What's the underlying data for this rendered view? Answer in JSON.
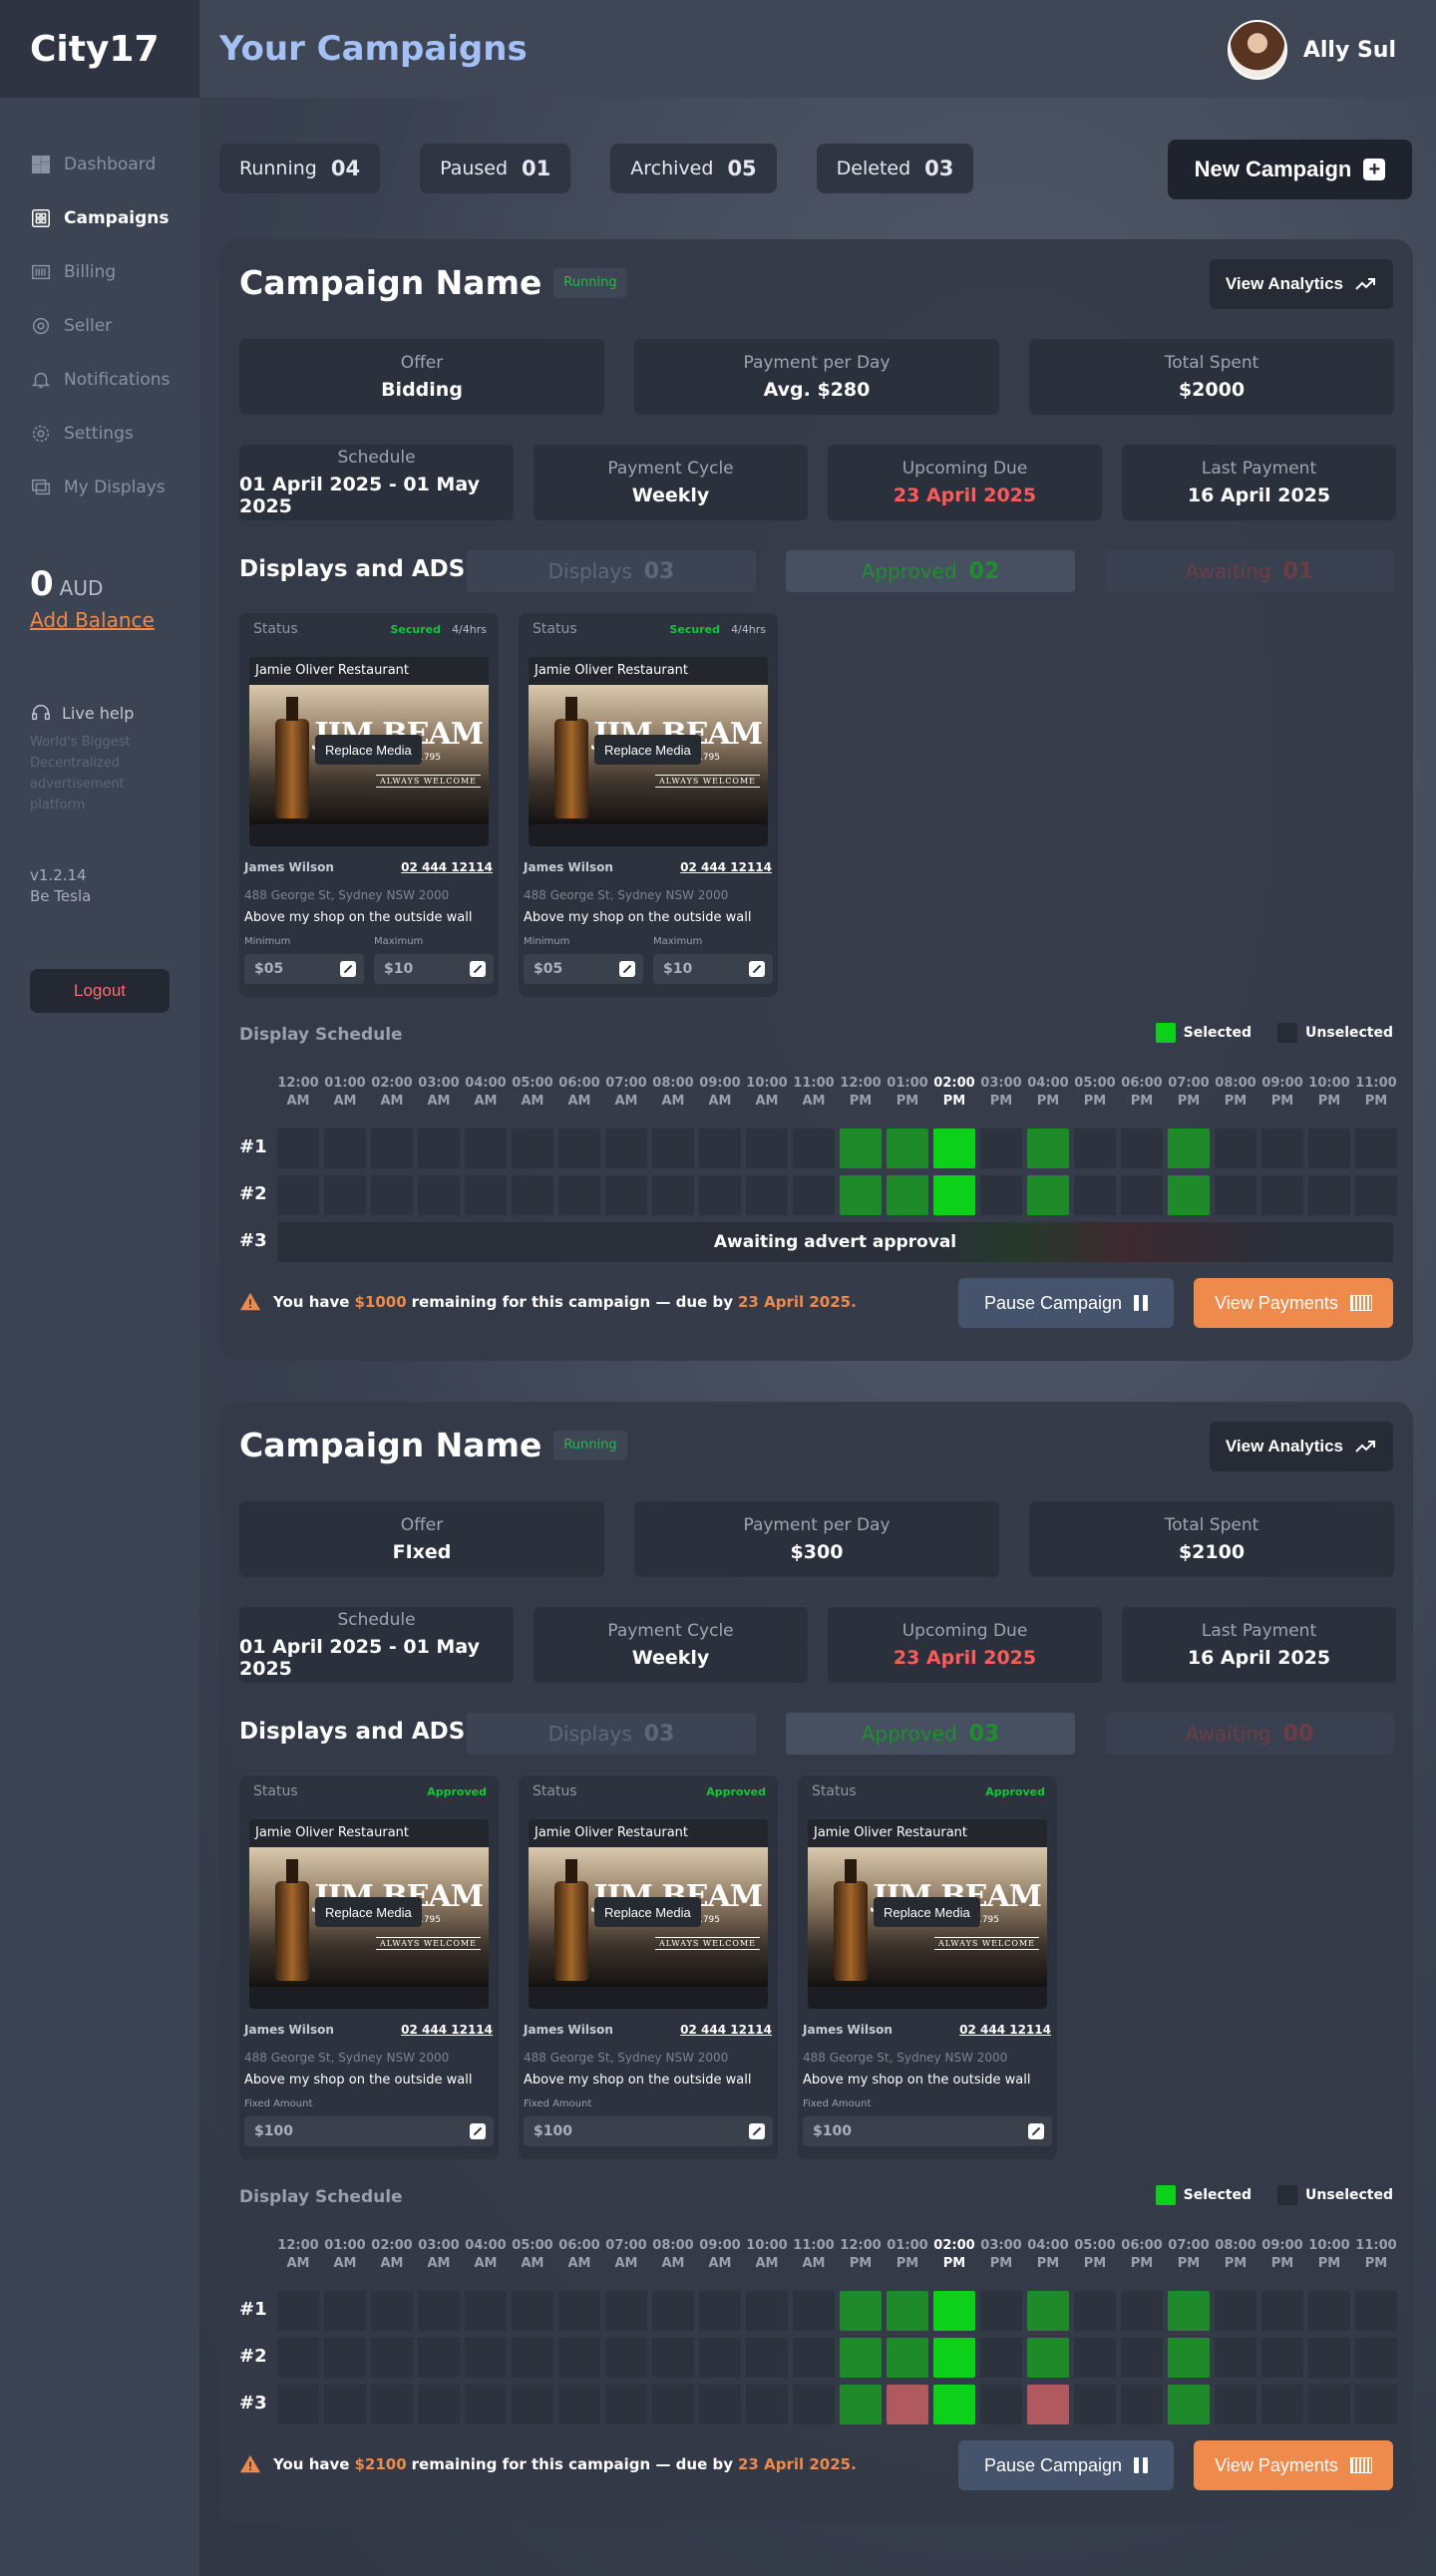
{
  "brand": "City17",
  "nav": [
    {
      "label": "Dashboard",
      "icon": "grid-icon"
    },
    {
      "label": "Campaigns",
      "icon": "campaigns-icon",
      "active": true
    },
    {
      "label": "Billing",
      "icon": "barcode-icon"
    },
    {
      "label": "Seller",
      "icon": "seller-icon"
    },
    {
      "label": "Notifications",
      "icon": "bell-icon"
    },
    {
      "label": "Settings",
      "icon": "gear-icon"
    },
    {
      "label": "My Displays",
      "icon": "displays-icon"
    }
  ],
  "balance": {
    "amount": "0",
    "currency": "AUD",
    "add": "Add Balance"
  },
  "help": {
    "title": "Live help",
    "desc": "World's Biggest Decentralized advertisement platform"
  },
  "version": {
    "v": "v1.2.14",
    "by": "Be Tesla"
  },
  "logout": "Logout",
  "header": {
    "title": "Your Campaigns",
    "user": "Ally Sul"
  },
  "filters": [
    {
      "label": "Running",
      "count": "04"
    },
    {
      "label": "Paused",
      "count": "01"
    },
    {
      "label": "Archived",
      "count": "05"
    },
    {
      "label": "Deleted",
      "count": "03"
    }
  ],
  "new_campaign": "New Campaign",
  "labels": {
    "view_analytics": "View Analytics",
    "offer": "Offer",
    "ppd": "Payment per Day",
    "spent": "Total Spent",
    "schedule": "Schedule",
    "cycle": "Payment Cycle",
    "due": "Upcoming Due",
    "last": "Last Payment",
    "displays_ads": "Displays and ADS",
    "displays": "Displays",
    "approved": "Approved",
    "awaiting": "Awaiting",
    "status": "Status",
    "replace": "Replace Media",
    "minimum": "Minimum",
    "maximum": "Maximum",
    "fixed": "Fixed Amount",
    "display_schedule": "Display Schedule",
    "selected": "Selected",
    "unselected": "Unselected",
    "pause": "Pause Campaign",
    "view_payments": "View Payments",
    "awaiting_approval": "Awaiting advert approval",
    "warn_pre": "You have",
    "warn_mid": "remaining for this campaign — due by"
  },
  "hours": [
    [
      "12:00",
      "AM"
    ],
    [
      "01:00",
      "AM"
    ],
    [
      "02:00",
      "AM"
    ],
    [
      "03:00",
      "AM"
    ],
    [
      "04:00",
      "AM"
    ],
    [
      "05:00",
      "AM"
    ],
    [
      "06:00",
      "AM"
    ],
    [
      "07:00",
      "AM"
    ],
    [
      "08:00",
      "AM"
    ],
    [
      "09:00",
      "AM"
    ],
    [
      "10:00",
      "AM"
    ],
    [
      "11:00",
      "AM"
    ],
    [
      "12:00",
      "PM"
    ],
    [
      "01:00",
      "PM"
    ],
    [
      "02:00",
      "PM"
    ],
    [
      "03:00",
      "PM"
    ],
    [
      "04:00",
      "PM"
    ],
    [
      "05:00",
      "PM"
    ],
    [
      "06:00",
      "PM"
    ],
    [
      "07:00",
      "PM"
    ],
    [
      "08:00",
      "PM"
    ],
    [
      "09:00",
      "PM"
    ],
    [
      "10:00",
      "PM"
    ],
    [
      "11:00",
      "PM"
    ]
  ],
  "rows": [
    "#1",
    "#2",
    "#3"
  ],
  "media": {
    "restaurant": "Jamie Oliver Restaurant",
    "brand_text": "JIM BEAM",
    "since": "SINCE 1795",
    "tagline": "ALWAYS WELCOME"
  },
  "colors": {
    "accent": "#ED8A4C",
    "selected": "#0DD01A",
    "approved": "#19C43A",
    "due": "#FF5B5B",
    "title": "#A4C0F4"
  },
  "campaigns": [
    {
      "name": "Campaign Name",
      "status": "Running",
      "offer": "Bidding",
      "ppd": "Avg. $280",
      "spent": "$2000",
      "schedule": "01 April 2025 - 01 May 2025",
      "cycle": "Weekly",
      "due": "23 April 2025",
      "last": "16 April 2025",
      "displays": "03",
      "approved": "02",
      "awaiting": "01",
      "remaining": "$1000",
      "due_date": "23 April 2025.",
      "cards": [
        {
          "status": "Secured",
          "hrs": "4/4hrs",
          "owner": "James Wilson",
          "phone": "02 444 12114",
          "addr": "488 George St, Sydney NSW 2000",
          "desc": "Above my shop on the outside wall",
          "min": "$05",
          "max": "$10"
        },
        {
          "status": "Secured",
          "hrs": "4/4hrs",
          "owner": "James Wilson",
          "phone": "02 444 12114",
          "addr": "488 George St, Sydney NSW 2000",
          "desc": "Above my shop on the outside wall",
          "min": "$05",
          "max": "$10"
        }
      ]
    },
    {
      "name": "Campaign Name",
      "status": "Running",
      "offer": "FIxed",
      "ppd": "$300",
      "spent": "$2100",
      "schedule": "01 April 2025 - 01 May 2025",
      "cycle": "Weekly",
      "due": "23 April 2025",
      "last": "16 April 2025",
      "displays": "03",
      "approved": "03",
      "awaiting": "00",
      "remaining": "$2100",
      "due_date": "23 April 2025.",
      "cards": [
        {
          "status": "Approved",
          "owner": "James Wilson",
          "phone": "02 444 12114",
          "addr": "488 George St, Sydney NSW 2000",
          "desc": "Above my shop on the outside wall",
          "fixed": "$100"
        },
        {
          "status": "Approved",
          "owner": "James Wilson",
          "phone": "02 444 12114",
          "addr": "488 George St, Sydney NSW 2000",
          "desc": "Above my shop on the outside wall",
          "fixed": "$100"
        },
        {
          "status": "Approved",
          "owner": "James Wilson",
          "phone": "02 444 12114",
          "addr": "488 George St, Sydney NSW 2000",
          "desc": "Above my shop on the outside wall",
          "fixed": "$100"
        }
      ]
    }
  ],
  "schedules": [
    {
      "current_hour": "02:00 PM",
      "rows": [
        [
          "",
          "",
          "",
          "",
          "",
          "",
          "",
          "",
          "",
          "",
          "",
          "",
          "s",
          "s",
          "h",
          "",
          "s",
          "",
          "",
          "s",
          "",
          "",
          "",
          ""
        ],
        [
          "",
          "",
          "",
          "",
          "",
          "",
          "",
          "",
          "",
          "",
          "",
          "",
          "s",
          "s",
          "h",
          "",
          "s",
          "",
          "",
          "s",
          "",
          "",
          "",
          ""
        ]
      ],
      "awaiting_row": "#3"
    },
    {
      "current_hour": "02:00 PM",
      "rows": [
        [
          "",
          "",
          "",
          "",
          "",
          "",
          "",
          "",
          "",
          "",
          "",
          "",
          "s",
          "s",
          "h",
          "",
          "s",
          "",
          "",
          "s",
          "",
          "",
          "",
          ""
        ],
        [
          "",
          "",
          "",
          "",
          "",
          "",
          "",
          "",
          "",
          "",
          "",
          "",
          "s",
          "s",
          "h",
          "",
          "s",
          "",
          "",
          "s",
          "",
          "",
          "",
          ""
        ],
        [
          "",
          "",
          "",
          "",
          "",
          "",
          "",
          "",
          "",
          "",
          "",
          "",
          "s",
          "r",
          "h",
          "",
          "r",
          "",
          "",
          "s",
          "",
          "",
          "",
          ""
        ]
      ]
    }
  ]
}
